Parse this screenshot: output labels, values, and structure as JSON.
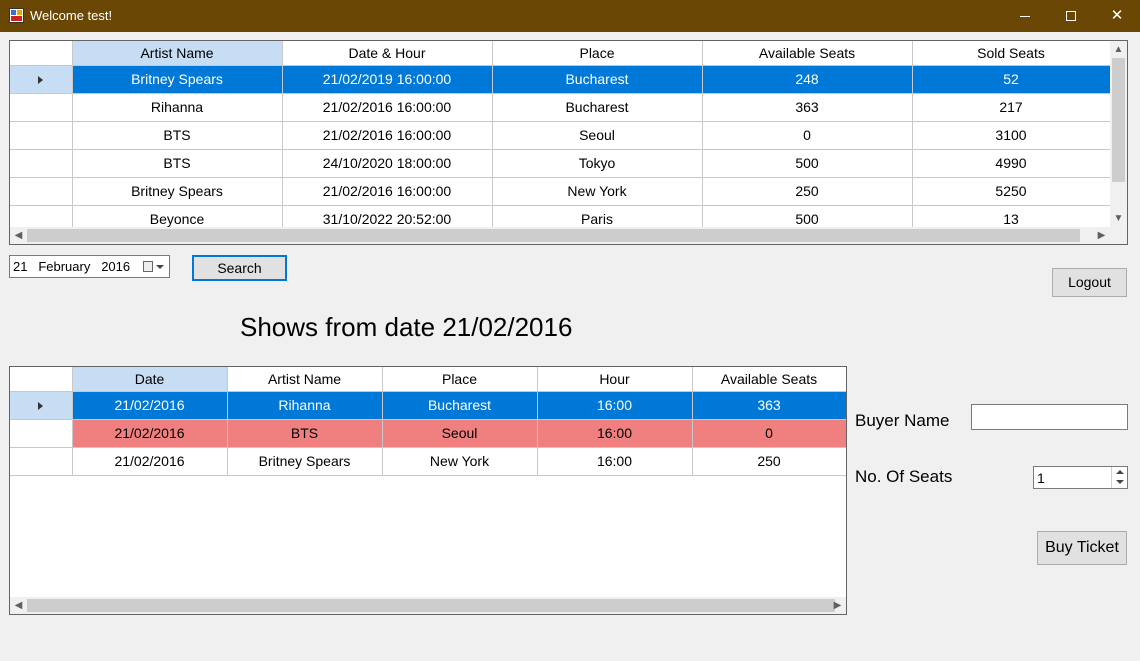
{
  "window": {
    "title": "Welcome test!",
    "controls": {
      "minimize": "minimize-icon",
      "maximize": "maximize-icon",
      "close": "✕"
    }
  },
  "concerts_grid": {
    "columns": [
      "Artist Name",
      "Date & Hour",
      "Place",
      "Available Seats",
      "Sold Seats"
    ],
    "rows": [
      [
        "Britney Spears",
        "21/02/2019 16:00:00",
        "Bucharest",
        "248",
        "52"
      ],
      [
        "Rihanna",
        "21/02/2016 16:00:00",
        "Bucharest",
        "363",
        "217"
      ],
      [
        "BTS",
        "21/02/2016 16:00:00",
        "Seoul",
        "0",
        "3100"
      ],
      [
        "BTS",
        "24/10/2020 18:00:00",
        "Tokyo",
        "500",
        "4990"
      ],
      [
        "Britney Spears",
        "21/02/2016 16:00:00",
        "New York",
        "250",
        "5250"
      ],
      [
        "Beyonce",
        "31/10/2022 20:52:00",
        "Paris",
        "500",
        "13"
      ]
    ],
    "selected_row": 0
  },
  "date_picker": {
    "day": "21",
    "month": "February",
    "year": "2016"
  },
  "search_button": "Search",
  "logout_button": "Logout",
  "shows_heading": "Shows from date 21/02/2016",
  "shows_grid": {
    "columns": [
      "Date",
      "Artist Name",
      "Place",
      "Hour",
      "Available Seats"
    ],
    "rows": [
      [
        "21/02/2016",
        "Rihanna",
        "Bucharest",
        "16:00",
        "363"
      ],
      [
        "21/02/2016",
        "BTS",
        "Seoul",
        "16:00",
        "0"
      ],
      [
        "21/02/2016",
        "Britney Spears",
        "New York",
        "16:00",
        "250"
      ]
    ],
    "selected_row": 0,
    "sold_out_row": 1
  },
  "buyer_name_label": "Buyer Name",
  "buyer_name_value": "",
  "seats_label": "No. Of Seats",
  "seats_value": "1",
  "buy_button": "Buy Ticket",
  "colors": {
    "titlebar": "#6b4706",
    "selection": "#0078d7",
    "header_sorted": "#c6ddf3",
    "sold_out_row": "#f08080"
  }
}
